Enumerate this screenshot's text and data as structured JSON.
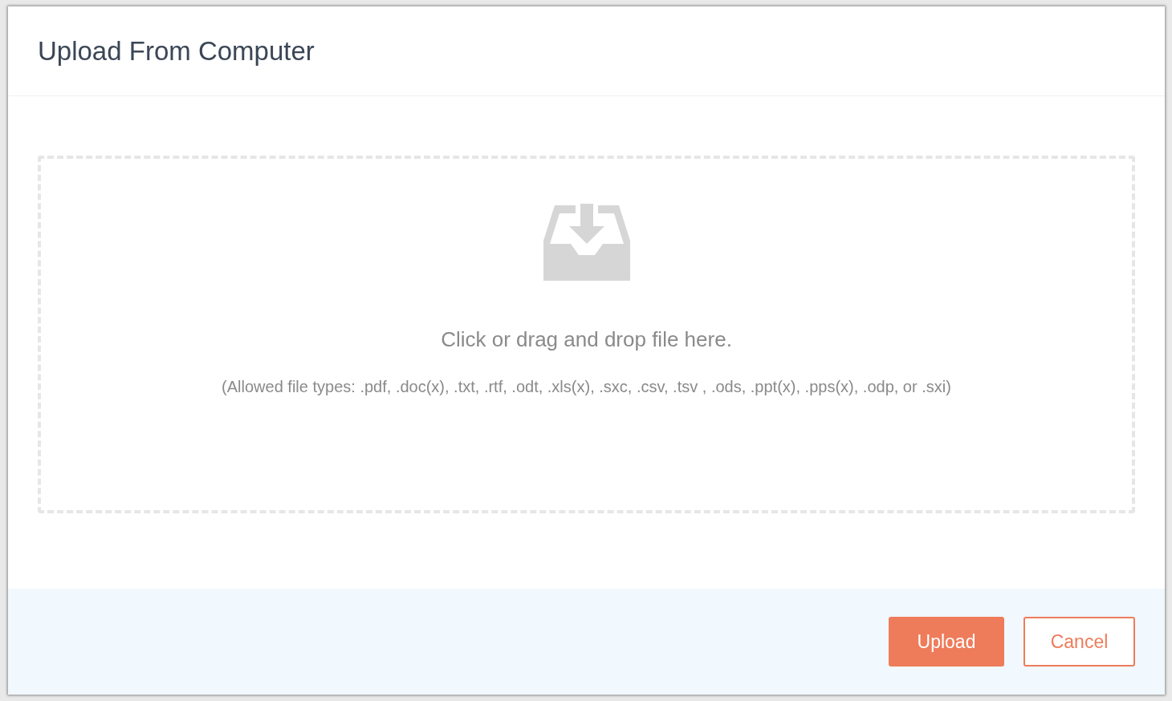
{
  "dialog": {
    "title": "Upload From Computer"
  },
  "dropzone": {
    "prompt": "Click or drag and drop file here.",
    "hint": "(Allowed file types: .pdf, .doc(x), .txt, .rtf, .odt, .xls(x), .sxc, .csv, .tsv , .ods, .ppt(x), .pps(x), .odp, or .sxi)"
  },
  "buttons": [
    {
      "label": "Upload",
      "kind": "primary"
    },
    {
      "label": "Cancel",
      "kind": "secondary"
    }
  ]
}
